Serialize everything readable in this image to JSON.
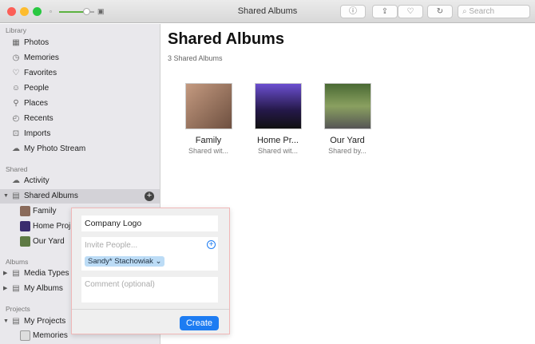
{
  "window": {
    "title": "Shared Albums",
    "search_placeholder": "Search"
  },
  "sidebar": {
    "library_label": "Library",
    "library": [
      {
        "label": "Photos",
        "icon": "photos-icon"
      },
      {
        "label": "Memories",
        "icon": "memories-icon"
      },
      {
        "label": "Favorites",
        "icon": "heart-icon"
      },
      {
        "label": "People",
        "icon": "people-icon"
      },
      {
        "label": "Places",
        "icon": "pin-icon"
      },
      {
        "label": "Recents",
        "icon": "recents-icon"
      },
      {
        "label": "Imports",
        "icon": "imports-icon"
      },
      {
        "label": "My Photo Stream",
        "icon": "cloud-icon"
      }
    ],
    "shared_label": "Shared",
    "activity": "Activity",
    "shared_albums": "Shared Albums",
    "shared_children": [
      "Family",
      "Home Proj",
      "Our Yard"
    ],
    "albums_label": "Albums",
    "media_types": "Media Types",
    "my_albums": "My Albums",
    "projects_label": "Projects",
    "my_projects": "My Projects",
    "project_children": [
      "Memories"
    ]
  },
  "main": {
    "title": "Shared Albums",
    "count": "3 Shared Albums",
    "albums": [
      {
        "name": "Family",
        "sub": "Shared wit...",
        "color": "#8a6a5a"
      },
      {
        "name": "Home Pr...",
        "sub": "Shared wit...",
        "color": "#3a2c6e"
      },
      {
        "name": "Our Yard",
        "sub": "Shared by...",
        "color": "#5e7a44"
      }
    ]
  },
  "popover": {
    "album_name": "Company Logo",
    "invite_placeholder": "Invite People...",
    "invitee": "Sandy* Stachowiak",
    "comment_placeholder": "Comment (optional)",
    "create_label": "Create"
  }
}
